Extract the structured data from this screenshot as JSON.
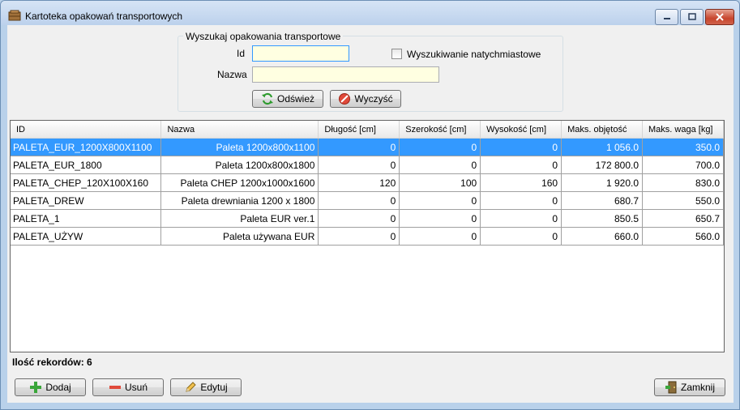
{
  "window": {
    "title": "Kartoteka opakowań transportowych"
  },
  "search": {
    "group_title": "Wyszukaj opakowania transportowe",
    "id_label": "Id",
    "id_value": "",
    "name_label": "Nazwa",
    "name_value": "",
    "instant_label": "Wyszukiwanie natychmiastowe",
    "instant_checked": false,
    "refresh_label": "Odśwież",
    "clear_label": "Wyczyść"
  },
  "grid": {
    "columns": [
      "ID",
      "Nazwa",
      "Długość [cm]",
      "Szerokość [cm]",
      "Wysokość [cm]",
      "Maks. objętość",
      "Maks. waga [kg]"
    ],
    "rows": [
      [
        "PALETA_EUR_1200X800X1100",
        "Paleta 1200x800x1100",
        "0",
        "0",
        "0",
        "1 056.0",
        "350.0"
      ],
      [
        "PALETA_EUR_1800",
        "Paleta 1200x800x1800",
        "0",
        "0",
        "0",
        "172 800.0",
        "700.0"
      ],
      [
        "PALETA_CHEP_120X100X160",
        "Paleta CHEP 1200x1000x1600",
        "120",
        "100",
        "160",
        "1 920.0",
        "830.0"
      ],
      [
        "PALETA_DREW",
        "Paleta drewniania 1200 x 1800",
        "0",
        "0",
        "0",
        "680.7",
        "550.0"
      ],
      [
        "PALETA_1",
        "Paleta EUR ver.1",
        "0",
        "0",
        "0",
        "850.5",
        "650.7"
      ],
      [
        "PALETA_UŻYW",
        "Paleta używana EUR",
        "0",
        "0",
        "0",
        "660.0",
        "560.0"
      ]
    ],
    "selected_row": 0
  },
  "footer": {
    "record_count": "Ilość rekordów: 6",
    "add_label": "Dodaj",
    "delete_label": "Usuń",
    "edit_label": "Edytuj",
    "close_label": "Zamknij"
  },
  "colors": {
    "selection": "#3399ff",
    "input_background": "#ffffe1"
  }
}
